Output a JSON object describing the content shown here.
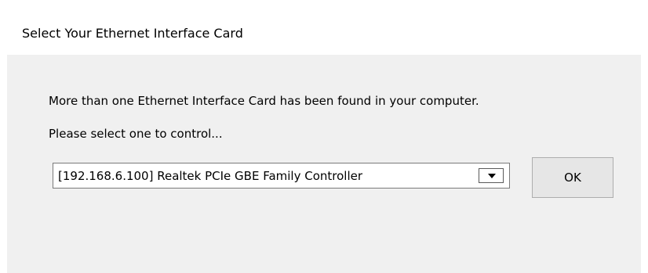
{
  "window": {
    "title": "Select Your Ethernet Interface Card"
  },
  "dialog": {
    "message_line1": "More than one Ethernet Interface Card has been found in your computer.",
    "message_line2": "Please select one to control...",
    "adapter_select": {
      "selected_value": "[192.168.6.100] Realtek PCIe GBE Family Controller"
    },
    "ok_label": "OK"
  },
  "colors": {
    "title_bar_background": "#ffffff",
    "dialog_background": "#f0f0f0",
    "button_background": "#e6e6e6",
    "button_border": "#adadad",
    "combo_border": "#7a7a7a"
  },
  "icons": {
    "dropdown": "chevron-down-icon"
  }
}
